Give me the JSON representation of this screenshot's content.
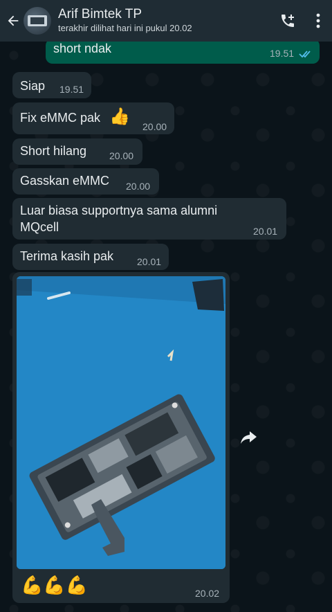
{
  "header": {
    "title": "Arif Bimtek TP",
    "subtitle": "terakhir dilihat hari ini pukul 20.02",
    "icons": [
      "back-arrow-icon",
      "add-call-icon",
      "more-vert-icon"
    ]
  },
  "messages": [
    {
      "direction": "out",
      "text": "short ndak",
      "time": "19.51",
      "status": "read"
    },
    {
      "direction": "in",
      "text": "Siap",
      "time": "19.51"
    },
    {
      "direction": "in",
      "text": "Fix eMMC pak",
      "emoji": "👍",
      "time": "20.00"
    },
    {
      "direction": "in",
      "text": "Short hilang",
      "time": "20.00"
    },
    {
      "direction": "in",
      "text": "Gasskan eMMC",
      "time": "20.00"
    },
    {
      "direction": "in",
      "text_line1": "Luar biasa supportnya sama alumni",
      "text_line2": "MQcell",
      "time": "20.01"
    },
    {
      "direction": "in",
      "text": "Terima kasih pak",
      "time": "20.01"
    },
    {
      "direction": "in",
      "type": "image",
      "caption": "💪💪💪",
      "time": "20.02"
    }
  ],
  "colors": {
    "header_bg": "#1f2c34",
    "chat_bg": "#0b141a",
    "incoming_bubble": "#202c33",
    "outgoing_bubble": "#005c4b",
    "read_ticks": "#53bdeb"
  }
}
